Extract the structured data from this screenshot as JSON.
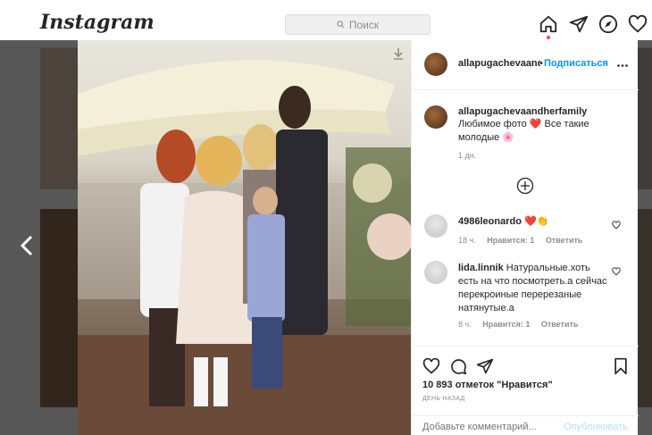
{
  "brand": {
    "logo": "Instagram"
  },
  "search": {
    "placeholder": "Поиск"
  },
  "nav": {
    "icons": [
      "home-icon",
      "direct-icon",
      "explore-icon",
      "heart-icon"
    ]
  },
  "post": {
    "author": "allapugachevaandherfamily",
    "author_head_display": "allapugachevaandh",
    "follow_label": "Подписаться",
    "caption_line1": "Любимое фото ❤️ Все такие",
    "caption_line2": "молодые 🌸",
    "caption_time": "1 дн.",
    "likes": "10 893 отметок \"Нравится\"",
    "date": "ДЕНЬ НАЗАД"
  },
  "comments": [
    {
      "user": "4986leonardo",
      "text": "❤️👏",
      "time": "18 ч.",
      "likes": "Нравится: 1",
      "reply": "Ответить"
    },
    {
      "user": "lida.linnik",
      "text": "Натуральные.хоть есть на что посмотреть.а сейчас перекроиные перерезаные натянутые.а",
      "time": "8 ч.",
      "likes": "Нравится: 1",
      "reply": "Ответить"
    }
  ],
  "comment_input": {
    "placeholder": "Добавьте комментарий..."
  },
  "publish_label": "Опубликовать"
}
